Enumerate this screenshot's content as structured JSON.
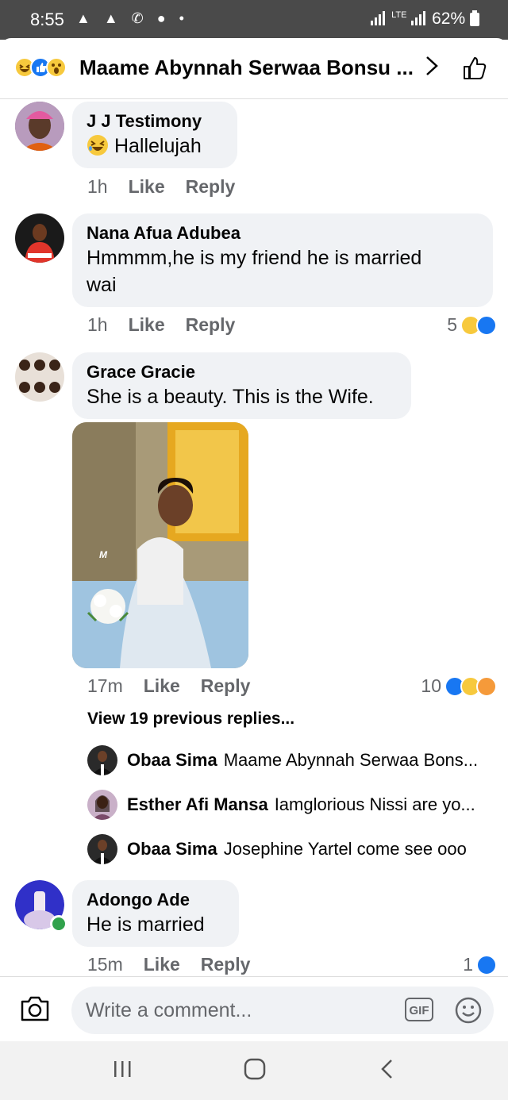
{
  "status_bar": {
    "time": "8:55",
    "notif_icons": "▲ ▲ ✆ ● •",
    "network": "LTE",
    "battery": "62%"
  },
  "header": {
    "title": "Maame Abynnah Serwaa Bonsu ...",
    "reaction_icons": [
      "haha-icon",
      "like-icon",
      "wow-icon"
    ]
  },
  "comments": [
    {
      "name": "J J Testimony",
      "text": "Hallelujah",
      "emoji": "laughing-emoji-icon",
      "time": "1h",
      "like": "Like",
      "reply": "Reply"
    },
    {
      "name": "Nana Afua Adubea",
      "text_line1": "Hmmmm,he is my friend he is married",
      "text_line2": "wai",
      "time": "1h",
      "like": "Like",
      "reply": "Reply",
      "reaction_count": "5"
    },
    {
      "name": "Grace Gracie",
      "text": "She is a beauty. This is the Wife.",
      "time": "17m",
      "like": "Like",
      "reply": "Reply",
      "reaction_count": "10",
      "photo_watermark": "M"
    },
    {
      "name": "Adongo Ade",
      "text": "He is married",
      "time": "15m",
      "like": "Like",
      "reply": "Reply",
      "reaction_count": "1"
    }
  ],
  "view_previous": "View 19 previous replies...",
  "replies": [
    {
      "name": "Obaa Sima",
      "text": "Maame Abynnah Serwaa Bons..."
    },
    {
      "name": "Esther Afi Mansa",
      "text": "Iamglorious Nissi are yo..."
    },
    {
      "name": "Obaa Sima",
      "text": "Josephine Yartel come see ooo"
    }
  ],
  "composer": {
    "placeholder": "Write a comment...",
    "gif_label": "GIF"
  },
  "colors": {
    "like_blue": "#1877f2",
    "bubble_gray": "#f0f2f5",
    "meta_gray": "#65676b",
    "status_bar": "#4a4a4a",
    "online_green": "#31a24c"
  }
}
